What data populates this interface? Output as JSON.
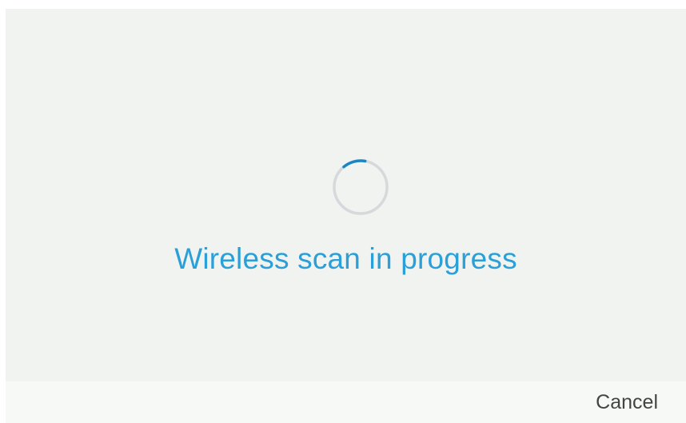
{
  "status": {
    "message": "Wireless scan in progress",
    "accent_color": "#2a9fd8",
    "spinner_icon": "loading-spinner-icon"
  },
  "softkeys": {
    "cancel_label": "Cancel"
  }
}
